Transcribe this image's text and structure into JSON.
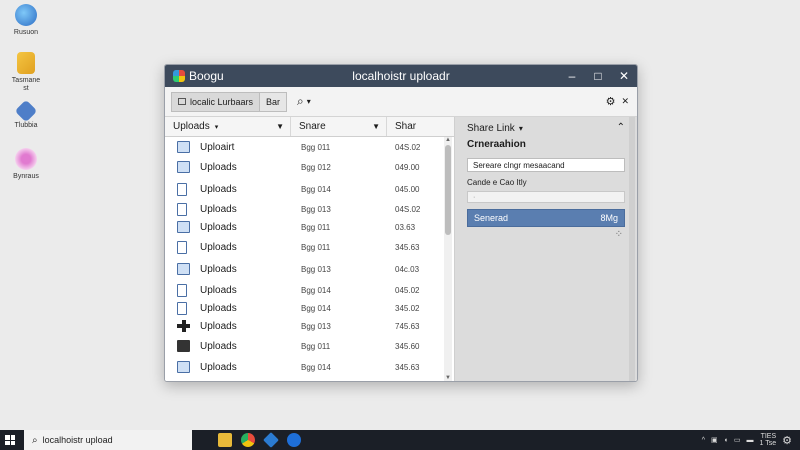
{
  "desktop": {
    "icons": [
      {
        "label": "Rusuon",
        "icon": "edge-icon",
        "color": "#3a86d6"
      },
      {
        "label": "Tasmane\nst",
        "icon": "folder-icon",
        "color": "#e6a23c"
      },
      {
        "label": "Tlubbia",
        "icon": "app-icon",
        "color": "#4e7ec8"
      },
      {
        "label": "Bynraus",
        "icon": "paint-icon",
        "color": "#d35bb5"
      }
    ]
  },
  "window": {
    "app_name": "Boogu",
    "title": "localhoistr uploadr",
    "controls": {
      "minimize": "–",
      "maximize": "□",
      "close": "✕"
    }
  },
  "toolbar": {
    "tab_active": "localic Lurbaars",
    "tab_other": "Bar",
    "search_icon": "⌕",
    "caret": "▾",
    "settings_icon": "⚙",
    "close_icon": "✕"
  },
  "file_list": {
    "headers": {
      "name": "Uploads",
      "share": "Snare",
      "size": "Shar"
    },
    "rows": [
      {
        "name": "Uploairt",
        "share": "Bgg 011",
        "size": "04S.02",
        "icon": "folder-icon"
      },
      {
        "name": "Uploads",
        "share": "Bgg 012",
        "size": "049.00",
        "icon": "folder-icon"
      },
      {
        "name": "Uploads",
        "share": "Bgg 014",
        "size": "045.00",
        "icon": "document-icon"
      },
      {
        "name": "Uploads",
        "share": "Bgg 013",
        "size": "04S.02",
        "icon": "document-icon"
      },
      {
        "name": "Uploads",
        "share": "Bgg 011",
        "size": "03.63",
        "icon": "folder-icon"
      },
      {
        "name": "Uploads",
        "share": "Bgg 011",
        "size": "345.63",
        "icon": "document-icon"
      },
      {
        "name": "Uploads",
        "share": "Bgg 013",
        "size": "04c.03",
        "icon": "folder-icon"
      },
      {
        "name": "Uploads",
        "share": "Bgg 014",
        "size": "045.02",
        "icon": "document-icon"
      },
      {
        "name": "Uploads",
        "share": "Bgg 014",
        "size": "345.02",
        "icon": "document-icon"
      },
      {
        "name": "Uploads",
        "share": "Bgg 013",
        "size": "745.63",
        "icon": "plus-icon"
      },
      {
        "name": "Uploads",
        "share": "Bgg 011",
        "size": "345.60",
        "icon": "drive-icon"
      },
      {
        "name": "Uploads",
        "share": "Bgg 014",
        "size": "345.63",
        "icon": "folder-icon"
      }
    ]
  },
  "share_panel": {
    "header": "Share Link",
    "section": "Crneraahion",
    "field_value": "Sereare clngr mesaacand",
    "label": "Cande e Cao Itly",
    "field2_value": "·",
    "button_label": "Senerad",
    "button_value": "8Mg"
  },
  "taskbar": {
    "search_text": "localhoistr upload",
    "clock_line1": "TIES",
    "clock_line2": "1 Tse"
  },
  "colors": {
    "titlebar": "#3d4a5c",
    "accent_button": "#5a7eb0",
    "taskbar": "#1b1f27"
  }
}
